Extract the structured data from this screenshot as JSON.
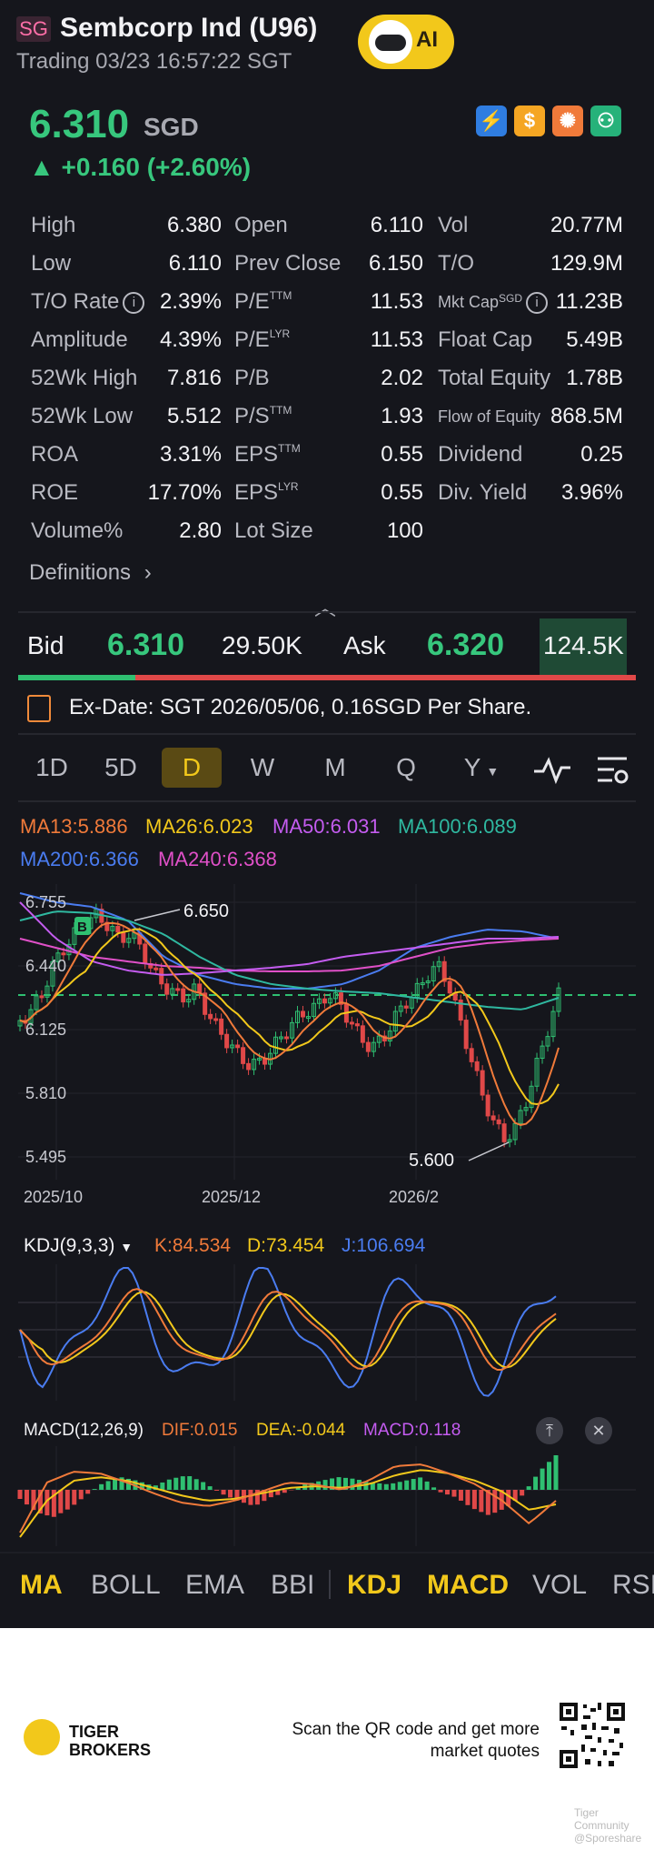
{
  "header": {
    "flag": "SG",
    "title": "Sembcorp Ind (U96)",
    "status": "Trading 03/23 16:57:22 SGT",
    "ai_label": "AI"
  },
  "quote": {
    "price": "6.310",
    "currency": "SGD",
    "change": "▲ +0.160 (+2.60%)"
  },
  "badges": [
    {
      "icon": "lightning-level2-icon",
      "text": "⚡",
      "color": "#2f7de1"
    },
    {
      "icon": "dollar-icon",
      "text": "$",
      "color": "#f5a623"
    },
    {
      "icon": "share-circle-icon",
      "text": "✺",
      "color": "#f07a3a"
    },
    {
      "icon": "money-hand-icon",
      "text": "⚇",
      "color": "#26b27a"
    }
  ],
  "stats": {
    "col1": [
      {
        "label": "High",
        "value": "6.380"
      },
      {
        "label": "Low",
        "value": "6.110"
      },
      {
        "label": "T/O Rate",
        "value": "2.39%"
      },
      {
        "label": "Amplitude",
        "value": "4.39%"
      },
      {
        "label": "52Wk High",
        "value": "7.816"
      },
      {
        "label": "52Wk Low",
        "value": "5.512"
      },
      {
        "label": "ROA",
        "value": "3.31%"
      },
      {
        "label": "ROE",
        "value": "17.70%"
      },
      {
        "label": "Volume%",
        "value": "2.80"
      }
    ],
    "col2": [
      {
        "label": "Open",
        "sup": "",
        "value": "6.110"
      },
      {
        "label": "Prev Close",
        "sup": "",
        "value": "6.150"
      },
      {
        "label": "P/E",
        "sup": "TTM",
        "value": "11.53"
      },
      {
        "label": "P/E",
        "sup": "LYR",
        "value": "11.53"
      },
      {
        "label": "P/B",
        "sup": "",
        "value": "2.02"
      },
      {
        "label": "P/S",
        "sup": "TTM",
        "value": "1.93"
      },
      {
        "label": "EPS",
        "sup": "TTM",
        "value": "0.55"
      },
      {
        "label": "EPS",
        "sup": "LYR",
        "value": "0.55"
      },
      {
        "label": "Lot Size",
        "sup": "",
        "value": "100"
      }
    ],
    "col3": [
      {
        "label": "Vol",
        "value": "20.77M"
      },
      {
        "label": "T/O",
        "value": "129.9M"
      },
      {
        "label": "Mkt Cap",
        "sup": "SGD",
        "value": "11.23B"
      },
      {
        "label": "Float Cap",
        "value": "5.49B"
      },
      {
        "label": "Total Equity",
        "value": "1.78B"
      },
      {
        "label": "Flow of Equity",
        "value": "868.5M"
      },
      {
        "label": "Dividend",
        "value": "0.25"
      },
      {
        "label": "Div. Yield",
        "value": "3.96%"
      }
    ]
  },
  "definitions": "Definitions",
  "orderbook": {
    "bid_label": "Bid",
    "bid_price": "6.310",
    "bid_volume": "29.50K",
    "ask_label": "Ask",
    "ask_price": "6.320",
    "ask_volume": "124.5K",
    "bid_share": 0.19
  },
  "exdate": "Ex-Date: SGT 2026/05/06, 0.16SGD Per Share.",
  "period_tabs": [
    "1D",
    "5D",
    "D",
    "W",
    "M",
    "Q",
    "Y"
  ],
  "active_tab": "D",
  "ma_legend": [
    {
      "text": "MA13:5.886",
      "color": "#f07a3a"
    },
    {
      "text": "MA26:6.023",
      "color": "#f2c81b"
    },
    {
      "text": "MA50:6.031",
      "color": "#c45cf0"
    },
    {
      "text": "MA100:6.089",
      "color": "#2fb8a0"
    },
    {
      "text": "MA200:6.366",
      "color": "#4a7cf0"
    },
    {
      "text": "MA240:6.368",
      "color": "#e050c8"
    }
  ],
  "price_chart": {
    "y_ticks": [
      "6.755",
      "6.440",
      "6.125",
      "5.810",
      "5.495"
    ],
    "x_ticks": [
      "2025/10",
      "2025/12",
      "2026/2"
    ],
    "high_label": "6.650",
    "low_label": "5.600",
    "buy_marker": "B"
  },
  "kdj": {
    "label": "KDJ(9,3,3)",
    "k": "K:84.534",
    "d": "D:73.454",
    "j": "J:106.694",
    "k_color": "#f07a3a",
    "d_color": "#f2c81b",
    "j_color": "#4a7cf0"
  },
  "macd": {
    "label": "MACD(12,26,9)",
    "dif": "DIF:0.015",
    "dea": "DEA:-0.044",
    "macd": "MACD:0.118"
  },
  "indicator_tabs": [
    "MA",
    "BOLL",
    "EMA",
    "BBI",
    "KDJ",
    "MACD",
    "VOL",
    "RSI"
  ],
  "highlighted_indicators": [
    "MA",
    "KDJ",
    "MACD"
  ],
  "footer": {
    "brand_line1": "TIGER",
    "brand_line2": "BROKERS",
    "scan_text": "Scan the QR code and get more market quotes",
    "watermark1": "Tiger Community",
    "watermark2": "@Sporeshare"
  }
}
